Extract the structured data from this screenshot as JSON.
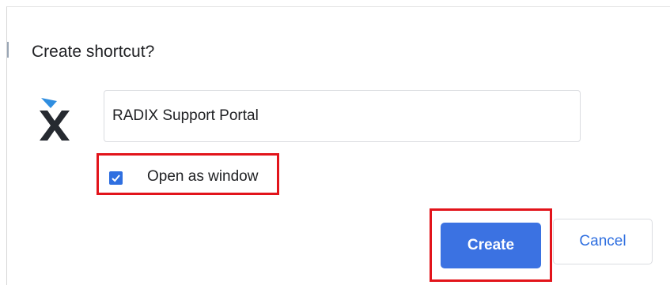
{
  "dialog": {
    "title": "Create shortcut?",
    "app_icon": "radix-x-logo-icon",
    "name_field": {
      "value": "RADIX Support Portal"
    },
    "open_as_window": {
      "label": "Open as window",
      "checked": true,
      "icon": "checkmark-icon"
    },
    "buttons": {
      "create_label": "Create",
      "cancel_label": "Cancel"
    }
  },
  "colors": {
    "accent": "#3b72e2",
    "highlight_outline": "#e2141b",
    "logo_dark": "#262a30",
    "logo_blue": "#2f8ee0"
  }
}
